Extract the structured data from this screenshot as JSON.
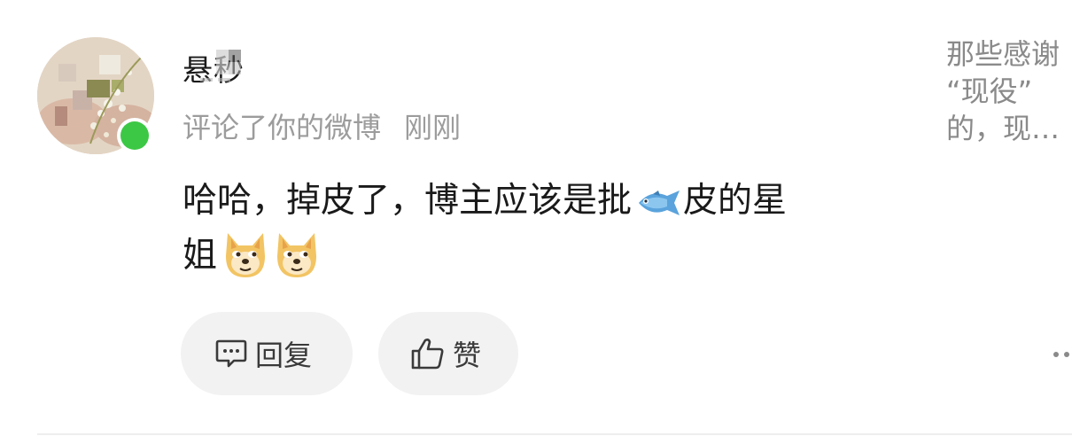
{
  "user": {
    "name": "悬秒",
    "online": true
  },
  "meta": {
    "action": "评论了你的微博",
    "time": "刚刚"
  },
  "comment": {
    "text_1": "哈哈，掉皮了，博主应该是批",
    "fish_icon": "fish-emoji",
    "text_2": "皮的星",
    "text_3": "姐",
    "doge_icon": "doge-emoji"
  },
  "actions": {
    "reply_label": "回复",
    "like_label": "赞"
  },
  "preview": {
    "lines": [
      "那些感谢",
      "“现役”",
      "的，现…"
    ]
  },
  "colors": {
    "online": "#3cc845",
    "button_bg": "#f2f2f2",
    "meta_text": "#9c9c9c"
  }
}
